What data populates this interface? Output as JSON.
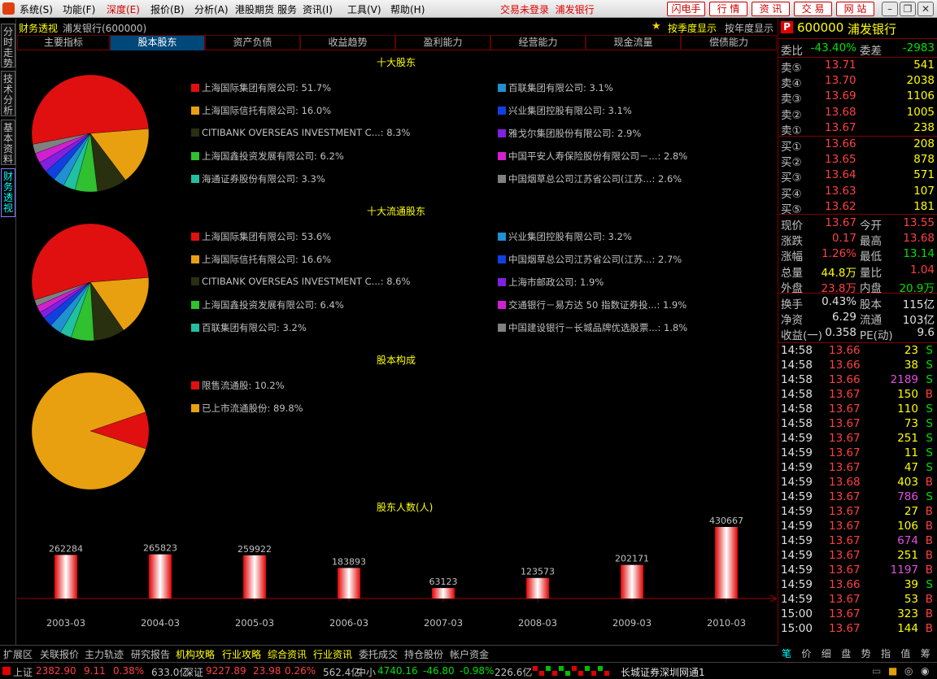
{
  "menubar": {
    "items": [
      "系统(S)",
      "功能(F)",
      "深度(E)",
      "报价(B)",
      "分析(A)",
      "港股期货",
      "服务",
      "资讯(I)",
      "工具(V)",
      "帮助(H)"
    ],
    "selected": "深度(E)",
    "status": "交易未登录",
    "stock": "浦发银行",
    "buttons": [
      "闪电手",
      "行 情",
      "资 讯",
      "交 易",
      "网 站"
    ]
  },
  "side_tabs": [
    "分时走势",
    "技术分析",
    "基本资料",
    "财务透视"
  ],
  "title": {
    "section": "财务透视",
    "stock": "浦发银行(600000)",
    "season": "按季度显示",
    "year": "按年度显示"
  },
  "tabs": [
    "主要指标",
    "股本股东",
    "资产负债",
    "收益趋势",
    "盈利能力",
    "经营能力",
    "现金流量",
    "偿债能力"
  ],
  "active_tab": "股本股东",
  "sections": {
    "top10": "十大股东",
    "top10float": "十大流通股东",
    "structure": "股本构成",
    "holders": "股东人数(人)"
  },
  "top10": [
    {
      "name": "上海国际集团有限公司",
      "pct": 51.7,
      "color": "#e01010"
    },
    {
      "name": "上海国际信托有限公司",
      "pct": 16.0,
      "color": "#e8a010"
    },
    {
      "name": "CITIBANK OVERSEAS INVESTMENT C...",
      "pct": 8.3,
      "color": "#283010"
    },
    {
      "name": "上海国鑫投资发展有限公司",
      "pct": 6.2,
      "color": "#30c030"
    },
    {
      "name": "海通证券股份有限公司",
      "pct": 3.3,
      "color": "#20c0a0"
    },
    {
      "name": "百联集团有限公司",
      "pct": 3.1,
      "color": "#2090d0"
    },
    {
      "name": "兴业集团控股有限公司",
      "pct": 3.1,
      "color": "#1040e0"
    },
    {
      "name": "雅戈尔集团股份有限公司",
      "pct": 2.9,
      "color": "#8020e0"
    },
    {
      "name": "中国平安人寿保险股份有限公司－...",
      "pct": 2.8,
      "color": "#d020d0"
    },
    {
      "name": "中国烟草总公司江苏省公司(江苏...",
      "pct": 2.6,
      "color": "#808080"
    }
  ],
  "top10float": [
    {
      "name": "上海国际集团有限公司",
      "pct": 53.6,
      "color": "#e01010"
    },
    {
      "name": "上海国际信托有限公司",
      "pct": 16.6,
      "color": "#e8a010"
    },
    {
      "name": "CITIBANK OVERSEAS INVESTMENT C...",
      "pct": 8.6,
      "color": "#283010"
    },
    {
      "name": "上海国鑫投资发展有限公司",
      "pct": 6.4,
      "color": "#30c030"
    },
    {
      "name": "百联集团有限公司",
      "pct": 3.2,
      "color": "#20c0a0"
    },
    {
      "name": "兴业集团控股有限公司",
      "pct": 3.2,
      "color": "#2090d0"
    },
    {
      "name": "中国烟草总公司江苏省公司(江苏...",
      "pct": 2.7,
      "color": "#1040e0"
    },
    {
      "name": "上海市邮政公司",
      "pct": 1.9,
      "color": "#8020e0"
    },
    {
      "name": "交通银行－易方达 50 指数证券投...",
      "pct": 1.9,
      "color": "#d020d0"
    },
    {
      "name": "中国建设银行－长城品牌优选股票...",
      "pct": 1.8,
      "color": "#808080"
    }
  ],
  "structure": [
    {
      "name": "限售流通股",
      "pct": 10.2,
      "color": "#e01010"
    },
    {
      "name": "已上市流通股份",
      "pct": 89.8,
      "color": "#e8a010"
    }
  ],
  "chart_data": {
    "type": "bar",
    "title": "股东人数(人)",
    "categories": [
      "2003-03",
      "2004-03",
      "2005-03",
      "2006-03",
      "2007-03",
      "2008-03",
      "2009-03",
      "2010-03"
    ],
    "values": [
      262284,
      265823,
      259922,
      183893,
      63123,
      123573,
      202171,
      430667
    ]
  },
  "quote": {
    "code": "600000",
    "name": "浦发银行",
    "wb_label": "委比",
    "wb": "-43.40%",
    "wc_label": "委差",
    "wc": "-2983",
    "sell": [
      [
        "卖⑤",
        "13.71",
        "541"
      ],
      [
        "卖④",
        "13.70",
        "2038"
      ],
      [
        "卖③",
        "13.69",
        "1106"
      ],
      [
        "卖②",
        "13.68",
        "1005"
      ],
      [
        "卖①",
        "13.67",
        "238"
      ]
    ],
    "buy": [
      [
        "买①",
        "13.66",
        "208"
      ],
      [
        "买②",
        "13.65",
        "878"
      ],
      [
        "买③",
        "13.64",
        "571"
      ],
      [
        "买④",
        "13.63",
        "107"
      ],
      [
        "买⑤",
        "13.62",
        "181"
      ]
    ],
    "stats1": [
      [
        "现价",
        "13.67",
        "今开",
        "13.55"
      ],
      [
        "涨跌",
        "0.17",
        "最高",
        "13.68"
      ],
      [
        "涨幅",
        "1.26%",
        "最低",
        "13.14"
      ],
      [
        "总量",
        "44.8万",
        "量比",
        "1.04"
      ],
      [
        "外盘",
        "23.8万",
        "内盘",
        "20.9万"
      ]
    ],
    "stats2": [
      [
        "换手",
        "0.43%",
        "股本",
        "115亿"
      ],
      [
        "净资",
        "6.29",
        "流通",
        "103亿"
      ],
      [
        "收益(一)",
        "0.358",
        "PE(动)",
        "9.6"
      ]
    ],
    "ticks": [
      [
        "14:58",
        "13.66",
        "23",
        "S"
      ],
      [
        "14:58",
        "13.66",
        "38",
        "S"
      ],
      [
        "14:58",
        "13.66",
        "2189",
        "S"
      ],
      [
        "14:58",
        "13.67",
        "150",
        "B"
      ],
      [
        "14:58",
        "13.67",
        "110",
        "S"
      ],
      [
        "14:58",
        "13.67",
        "73",
        "S"
      ],
      [
        "14:59",
        "13.67",
        "251",
        "S"
      ],
      [
        "14:59",
        "13.67",
        "11",
        "S"
      ],
      [
        "14:59",
        "13.67",
        "47",
        "S"
      ],
      [
        "14:59",
        "13.68",
        "403",
        "B"
      ],
      [
        "14:59",
        "13.67",
        "786",
        "S"
      ],
      [
        "14:59",
        "13.67",
        "27",
        "B"
      ],
      [
        "14:59",
        "13.67",
        "106",
        "B"
      ],
      [
        "14:59",
        "13.67",
        "674",
        "B"
      ],
      [
        "14:59",
        "13.67",
        "251",
        "B"
      ],
      [
        "14:59",
        "13.67",
        "1197",
        "B"
      ],
      [
        "14:59",
        "13.66",
        "39",
        "S"
      ],
      [
        "14:59",
        "13.67",
        "53",
        "B"
      ],
      [
        "15:00",
        "13.67",
        "323",
        "B"
      ],
      [
        "15:00",
        "13.67",
        "144",
        "B"
      ]
    ]
  },
  "bottom_tabs": [
    "扩展区",
    "关联报价",
    "主力轨迹",
    "研究报告",
    "机构攻略",
    "行业攻略",
    "综合资讯",
    "行业资讯",
    "委托成交",
    "持仓股份",
    "帐户资金"
  ],
  "right_tabs": [
    "笔",
    "价",
    "细",
    "盘",
    "势",
    "指",
    "值",
    "筹"
  ],
  "status": {
    "sh_label": "上证",
    "sh": "2382.90",
    "sh_chg": "9.11",
    "sh_pct": "0.38%",
    "sh_amt": "633.0亿",
    "sz_label": "深证",
    "sz": "9227.89",
    "sz_chg": "23.98",
    "sz_pct": "0.26%",
    "sz_amt": "562.4亿",
    "zx_label": "中小",
    "zx": "4740.16",
    "zx_chg": "-46.80",
    "zx_pct": "-0.98%",
    "zx_amt": "226.6亿",
    "broker": "长城证券深圳网通1"
  }
}
